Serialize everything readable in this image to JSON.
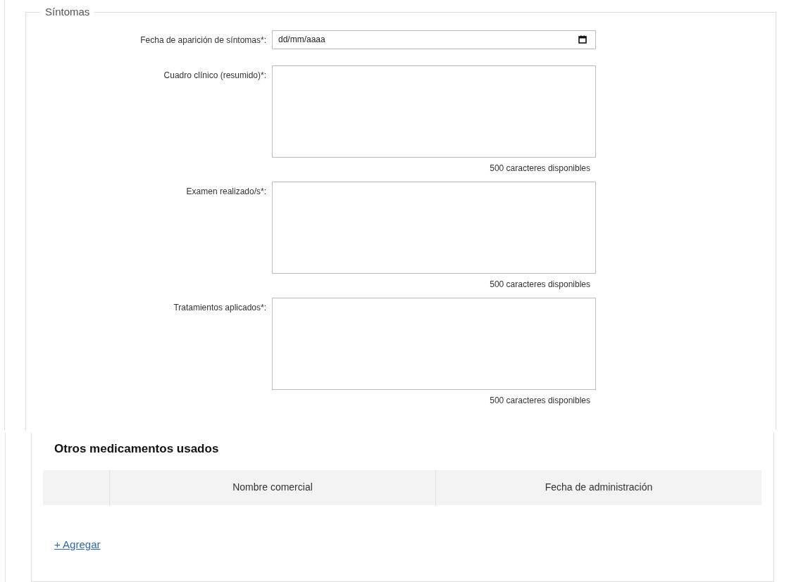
{
  "symptoms": {
    "legend": "Síntomas",
    "fields": [
      {
        "kind": "date",
        "label": "Fecha de aparición de síntomas*:",
        "placeholder": "dd/mm/aaaa"
      },
      {
        "kind": "textarea",
        "label": "Cuadro clínico (resumido)*:",
        "counter": "500 caracteres disponibles"
      },
      {
        "kind": "textarea",
        "label": "Examen realizado/s*:",
        "counter": "500 caracteres disponibles"
      },
      {
        "kind": "textarea",
        "label": "Tratamientos aplicados*:",
        "counter": "500 caracteres disponibles"
      }
    ]
  },
  "medications": {
    "heading": "Otros medicamentos usados",
    "columns": [
      "Nombre comercial",
      "Fecha de administración"
    ],
    "add_link": "+ Agregar"
  }
}
